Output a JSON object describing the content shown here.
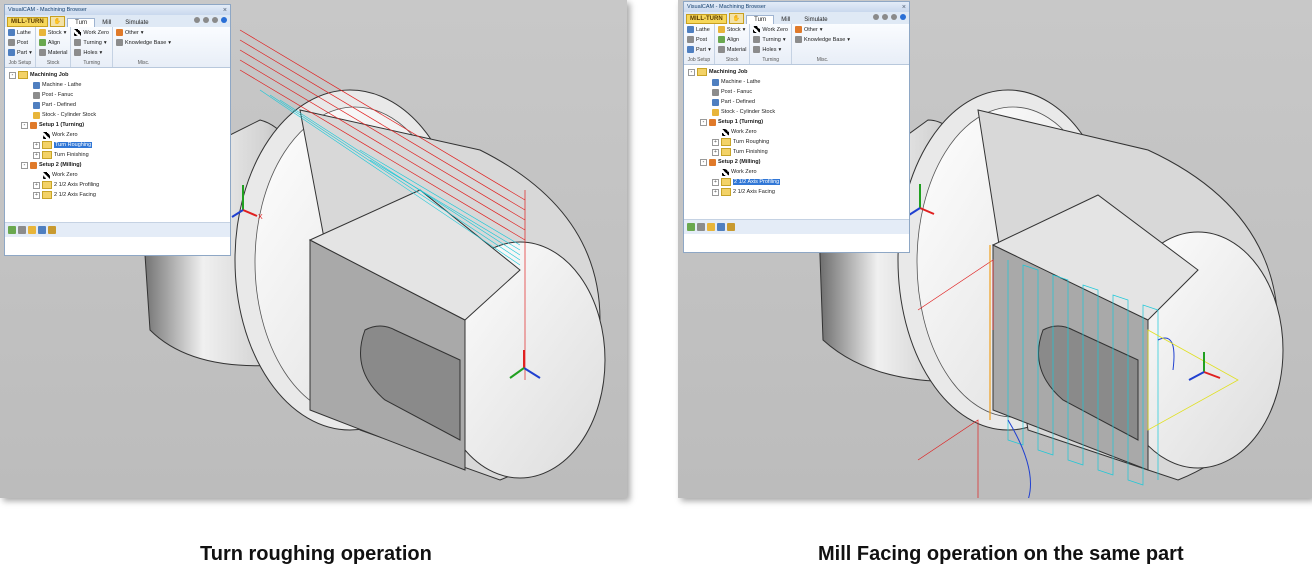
{
  "browser": {
    "title": "VisualCAM - Machining Browser",
    "close_glyph": "×",
    "tabs": [
      "MILL-TURN",
      "Turn",
      "Mill",
      "Simulate"
    ],
    "groups": [
      {
        "label": "Job Setup",
        "items": [
          {
            "label": "Lathe",
            "icon": "lathe-icon"
          },
          {
            "label": "Post",
            "icon": "post-icon"
          },
          {
            "label": "Part",
            "icon": "part-icon",
            "dropdown": true
          }
        ]
      },
      {
        "label": "Stock",
        "items": [
          {
            "label": "Stock",
            "icon": "stock-icon",
            "dropdown": true
          },
          {
            "label": "Align",
            "icon": "align-icon"
          },
          {
            "label": "Material",
            "icon": "material-icon"
          }
        ]
      },
      {
        "label": "Turning",
        "items": [
          {
            "label": "Work Zero",
            "icon": "work-zero-icon"
          },
          {
            "label": "Turning",
            "icon": "turning-icon",
            "dropdown": true
          },
          {
            "label": "Holes",
            "icon": "holes-icon",
            "dropdown": true
          }
        ]
      },
      {
        "label": "Misc.",
        "items": [
          {
            "label": "Other",
            "icon": "other-icon",
            "dropdown": true
          },
          {
            "label": "Knowledge Base",
            "icon": "knowledge-base-icon",
            "dropdown": true
          }
        ]
      }
    ],
    "tree": [
      {
        "label": "Machining Job",
        "level": 0,
        "bold": true,
        "icon": "folder-icon",
        "pm": "-"
      },
      {
        "label": "Machine - Lathe",
        "level": 2,
        "icon": "machine-icon"
      },
      {
        "label": "Post - Fanuc",
        "level": 2,
        "icon": "post-icon"
      },
      {
        "label": "Part - Defined",
        "level": 2,
        "icon": "part-icon"
      },
      {
        "label": "Stock - Cylinder Stock",
        "level": 2,
        "icon": "stock-icon"
      },
      {
        "label": "Setup 1 (Turning)",
        "level": 1,
        "bold": true,
        "icon": "setup-icon",
        "pm": "-"
      },
      {
        "label": "Work Zero",
        "level": 3,
        "icon": "work-zero-icon"
      },
      {
        "label": "Turn Roughing",
        "level": 2,
        "icon": "folder-icon",
        "pm": "+"
      },
      {
        "label": "Turn Finishing",
        "level": 2,
        "icon": "folder-icon",
        "pm": "+"
      },
      {
        "label": "Setup 2 (Milling)",
        "level": 1,
        "bold": true,
        "icon": "setup-icon",
        "pm": "-"
      },
      {
        "label": "Work Zero",
        "level": 3,
        "icon": "work-zero-icon"
      },
      {
        "label": "2 1/2 Axis Profiling",
        "level": 2,
        "icon": "folder-icon",
        "pm": "+"
      },
      {
        "label": "2 1/2 Axis Facing",
        "level": 2,
        "icon": "folder-icon",
        "pm": "+"
      }
    ]
  },
  "panels": [
    {
      "caption": "Turn roughing operation",
      "selected_index": 7,
      "active_tab": "Turn"
    },
    {
      "caption": "Mill Facing operation on the same part",
      "selected_index": 11,
      "active_tab": "Turn"
    }
  ],
  "axis_labels": {
    "x": "X",
    "y": "Y",
    "z": "Z"
  },
  "colors": {
    "selection": "#3177d6",
    "toolpath_cyan": "#19c8d8",
    "toolpath_red": "#e02020",
    "axis_x": "#e02020",
    "axis_y": "#20a020",
    "axis_z": "#2040d0"
  }
}
